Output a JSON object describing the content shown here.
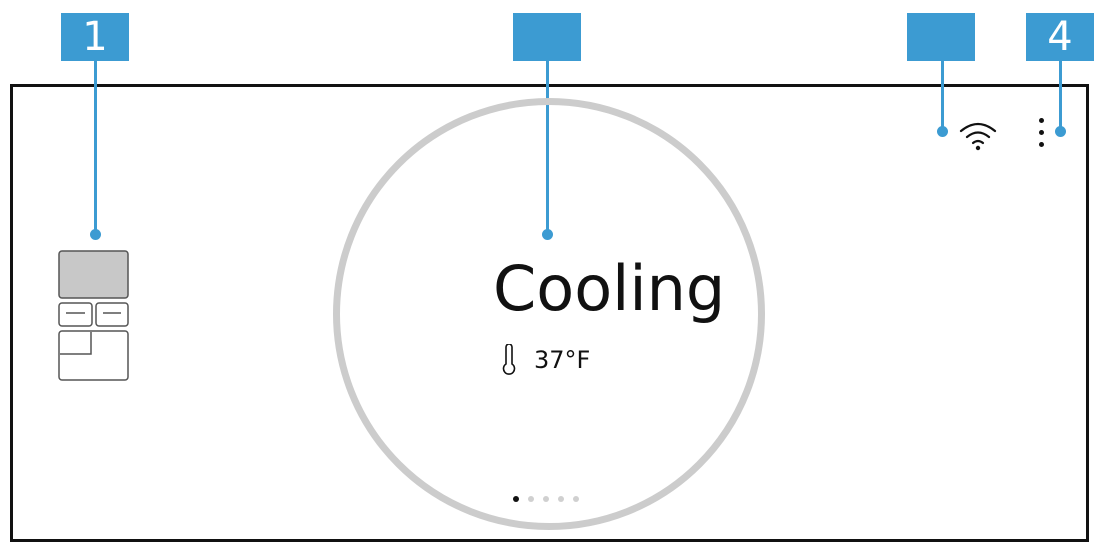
{
  "callouts": [
    {
      "label": "1"
    },
    {
      "label": ""
    },
    {
      "label": ""
    },
    {
      "label": "4"
    }
  ],
  "display": {
    "status": "Cooling",
    "temperature": "37°F",
    "page_count": 5,
    "active_page": 1
  },
  "icons": {
    "appliance": "fridge-compartments-icon",
    "thermometer": "thermometer-icon",
    "wifi": "wifi-icon",
    "menu": "more-vertical-icon"
  },
  "colors": {
    "callout": "#3c9bd2",
    "dial_ring": "#cccccc",
    "fridge_selected": "#c8c8c8"
  }
}
